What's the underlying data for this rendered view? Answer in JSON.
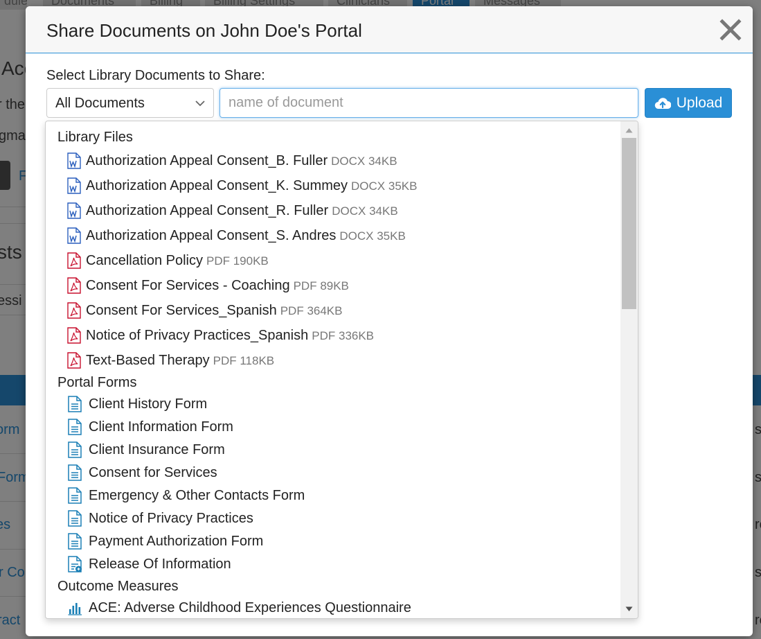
{
  "background": {
    "tabs": [
      "dule",
      "Documents",
      "Billing",
      "Billing Settings",
      "Clinicians",
      "Portal",
      "Messages"
    ],
    "fragments": {
      "acc": "Acc",
      "for_the": "r the",
      "gma": "gma",
      "f_link": "F",
      "sts": "sts",
      "essi": "essi",
      "orm": "orm",
      "form": "Form",
      "es": "es",
      "r_co": "r Co",
      "ract": "ract",
      "documents_placeholder": "locuments",
      "right_si1": "si",
      "right_si2": "si",
      "right_re1": "re",
      "right_si3": "si",
      "right_re2": "re"
    }
  },
  "modal": {
    "title": "Share Documents on John Doe's Portal",
    "section_label": "Select Library Documents to Share:",
    "filter_select": {
      "selected": "All Documents"
    },
    "search": {
      "value": "",
      "placeholder": "name of document"
    },
    "upload_label": "Upload"
  },
  "dropdown": {
    "library_files": {
      "header": "Library Files",
      "items": [
        {
          "name": "Authorization Appeal Consent_B. Fuller",
          "type": "DOCX",
          "size": "34KB",
          "icon": "word-doc-icon"
        },
        {
          "name": "Authorization Appeal Consent_K. Summey",
          "type": "DOCX",
          "size": "35KB",
          "icon": "word-doc-icon"
        },
        {
          "name": "Authorization Appeal Consent_R. Fuller",
          "type": "DOCX",
          "size": "34KB",
          "icon": "word-doc-icon"
        },
        {
          "name": "Authorization Appeal Consent_S. Andres",
          "type": "DOCX",
          "size": "35KB",
          "icon": "word-doc-icon"
        },
        {
          "name": "Cancellation Policy",
          "type": "PDF",
          "size": "190KB",
          "icon": "pdf-icon"
        },
        {
          "name": "Consent For Services - Coaching",
          "type": "PDF",
          "size": "89KB",
          "icon": "pdf-icon"
        },
        {
          "name": "Consent For Services_Spanish",
          "type": "PDF",
          "size": "364KB",
          "icon": "pdf-icon"
        },
        {
          "name": "Notice of Privacy Practices_Spanish",
          "type": "PDF",
          "size": "336KB",
          "icon": "pdf-icon"
        },
        {
          "name": "Text-Based Therapy",
          "type": "PDF",
          "size": "118KB",
          "icon": "pdf-icon"
        }
      ]
    },
    "portal_forms": {
      "header": "Portal Forms",
      "items": [
        {
          "name": "Client History Form",
          "icon": "form-icon"
        },
        {
          "name": "Client Information Form",
          "icon": "form-icon"
        },
        {
          "name": "Client Insurance Form",
          "icon": "form-icon"
        },
        {
          "name": "Consent for Services",
          "icon": "form-icon"
        },
        {
          "name": "Emergency & Other Contacts Form",
          "icon": "form-icon"
        },
        {
          "name": "Notice of Privacy Practices",
          "icon": "form-icon"
        },
        {
          "name": "Payment Authorization Form",
          "icon": "form-icon"
        },
        {
          "name": "Release Of Information",
          "icon": "release-form-icon"
        }
      ]
    },
    "outcome_measures": {
      "header": "Outcome Measures",
      "items": [
        {
          "name": "ACE: Adverse Childhood Experiences Questionnaire",
          "icon": "bar-chart-icon"
        }
      ]
    }
  },
  "colors": {
    "accent": "#2a8fd6",
    "word": "#2b5fbd",
    "pdf": "#c8102e",
    "form": "#1a7fb5"
  }
}
